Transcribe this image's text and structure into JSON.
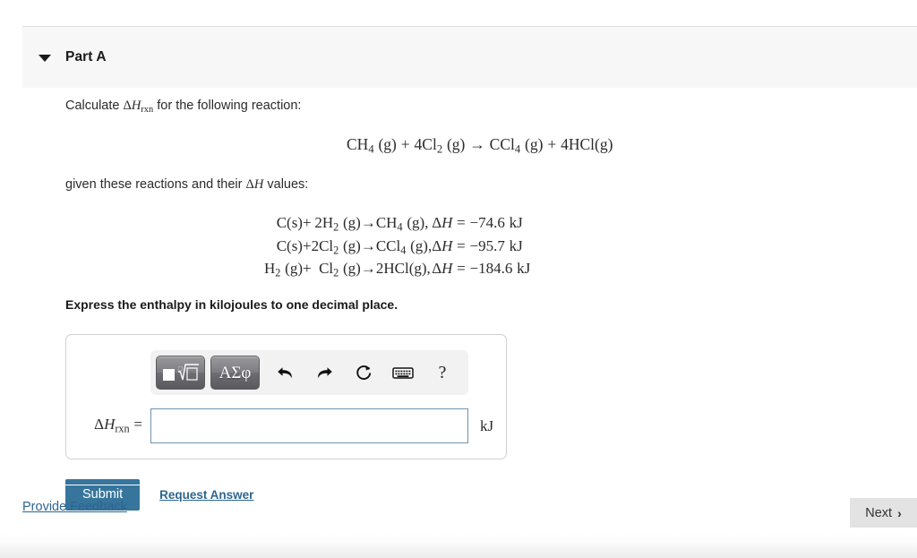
{
  "header": {
    "caret_icon": "chevron-down-icon",
    "title": "Part A"
  },
  "question": {
    "prompt_prefix": "Calculate",
    "prompt_symbol": "ΔH",
    "prompt_symbol_sub": "rxn",
    "prompt_suffix": "for the following reaction:",
    "main_equation": "CH₄(g) + 4Cl₂(g) → CCl₄(g) + 4HCl(g)",
    "given_prefix": "given these reactions and their",
    "given_symbol": "ΔH",
    "given_suffix": "values:",
    "instruction": "Express the enthalpy in kilojoules to one decimal place."
  },
  "reactions": {
    "columns": [
      "reactant1",
      "plus",
      "reactant2",
      "arrow",
      "product",
      "enthalpy"
    ],
    "plus_sign": "+",
    "arrow_sign": "→",
    "rows": [
      {
        "reactant1": "C(s)",
        "reactant1_parts": [
          {
            "t": "C",
            "k": "up"
          },
          {
            "t": "(s)",
            "k": "up"
          }
        ],
        "reactant2_parts": [
          {
            "t": "2H",
            "k": "up"
          },
          {
            "t": "2",
            "k": "sub"
          },
          {
            "t": "(g)",
            "k": "up"
          }
        ],
        "product_parts": [
          {
            "t": "CH",
            "k": "up"
          },
          {
            "t": "4",
            "k": "sub"
          },
          {
            "t": "(g),",
            "k": "up"
          }
        ],
        "enthalpy_symbol": "ΔH",
        "enthalpy_equals": "=",
        "enthalpy_value": "−74.6",
        "enthalpy_unit": "kJ"
      },
      {
        "reactant1": "C(s)",
        "reactant1_parts": [
          {
            "t": "C",
            "k": "up"
          },
          {
            "t": "(s)",
            "k": "up"
          }
        ],
        "reactant2_parts": [
          {
            "t": "2Cl",
            "k": "up"
          },
          {
            "t": "2",
            "k": "sub"
          },
          {
            "t": "(g)",
            "k": "up"
          }
        ],
        "product_parts": [
          {
            "t": "CCl",
            "k": "up"
          },
          {
            "t": "4",
            "k": "sub"
          },
          {
            "t": "(g),",
            "k": "up"
          }
        ],
        "enthalpy_symbol": "ΔH",
        "enthalpy_equals": "=",
        "enthalpy_value": "−95.7",
        "enthalpy_unit": "kJ"
      },
      {
        "reactant1": "H2(g)",
        "reactant1_parts": [
          {
            "t": "H",
            "k": "up"
          },
          {
            "t": "2",
            "k": "sub"
          },
          {
            "t": "(g)",
            "k": "up"
          }
        ],
        "reactant2_parts": [
          {
            "t": "Cl",
            "k": "up"
          },
          {
            "t": "2",
            "k": "sub"
          },
          {
            "t": "(g)",
            "k": "up"
          }
        ],
        "product_parts": [
          {
            "t": "2HCl",
            "k": "up"
          },
          {
            "t": "(g),",
            "k": "up"
          }
        ],
        "enthalpy_symbol": "ΔH",
        "enthalpy_equals": "=",
        "enthalpy_value": "−184.6",
        "enthalpy_unit": "kJ"
      }
    ]
  },
  "answer": {
    "label_symbol": "ΔH",
    "label_sub": "rxn",
    "label_equals": "=",
    "value": "",
    "placeholder": "",
    "unit": "kJ",
    "toolbar": {
      "template_button": {
        "name": "math-template-button",
        "label": ""
      },
      "greek_button": {
        "name": "greek-symbols-button",
        "label": "ΑΣφ"
      },
      "undo_button": {
        "name": "undo-icon",
        "label": ""
      },
      "redo_button": {
        "name": "redo-icon",
        "label": ""
      },
      "reset_button": {
        "name": "reset-icon",
        "label": ""
      },
      "keyboard_button": {
        "name": "keyboard-icon",
        "label": ""
      },
      "help_button": {
        "name": "help-icon",
        "label": "?"
      }
    }
  },
  "actions": {
    "submit_label": "Submit",
    "request_answer_label": "Request Answer"
  },
  "footer": {
    "feedback_label": "Provide Feedback",
    "next_label": "Next",
    "next_chevron": "›"
  },
  "colors": {
    "submit_blue": "#37759c",
    "link_blue": "#2c6690",
    "header_gray": "#f7f7f7",
    "next_gray": "#e3e3e3",
    "input_border": "#6d93b0"
  }
}
